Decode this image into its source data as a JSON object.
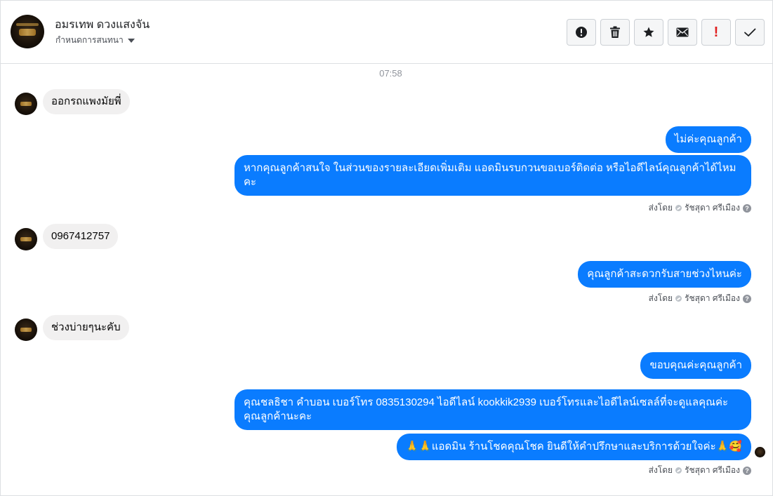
{
  "header": {
    "contact_name": "อมรเทพ ดวงแสงจัน",
    "subtitle": "กำหนดการสนทนา",
    "avatar_icon": "contact-avatar-image",
    "actions": [
      {
        "name": "report-button",
        "icon": "alert-circle-icon"
      },
      {
        "name": "delete-button",
        "icon": "trash-icon"
      },
      {
        "name": "star-button",
        "icon": "star-icon"
      },
      {
        "name": "mark-unread-button",
        "icon": "envelope-icon"
      },
      {
        "name": "spam-button",
        "icon": "exclamation-icon",
        "glyph": "!"
      },
      {
        "name": "mark-done-button",
        "icon": "checkmark-icon"
      }
    ]
  },
  "conversation": {
    "timestamp": "07:58",
    "messages": [
      {
        "direction": "in",
        "text": "ออกรถแพงมัยพี่"
      },
      {
        "direction": "out",
        "text": "ไม่ค่ะคุณลูกค้า"
      },
      {
        "direction": "out",
        "text": "หากคุณลูกค้าสนใจ ในส่วนของรายละเอียดเพิ่มเติม แอดมินรบกวนขอเบอร์ติดต่อ หรือไอดีไลน์คุณลูกค้าได้ไหมคะ"
      },
      {
        "direction": "in",
        "text": "0967412757"
      },
      {
        "direction": "out",
        "text": "คุณลูกค้าสะดวกรับสายช่วงไหนค่ะ"
      },
      {
        "direction": "in",
        "text": "ช่วงบ่ายๆนะคับ"
      },
      {
        "direction": "out",
        "text": "ขอบคุณค่ะคุณลูกค้า"
      },
      {
        "direction": "out",
        "text": "คุณชลธิชา คำบอน เบอร์โทร 0835130294  ไอดีไลน์ kookkik2939   เบอร์โทรและไอดีไลน์เซลล์ที่จะดูแลคุณค่ะคุณลูกค้านะคะ"
      },
      {
        "direction": "out",
        "text": "🙏🙏แอดมิน ร้านโชคคุณโชค ยินดีให้คำปรึกษาและบริการด้วยใจค่ะ🙏🥰"
      }
    ],
    "sent_by": {
      "prefix": "ส่งโดย",
      "agent": "รัชสุดา ศรีเมือง",
      "help_glyph": "?"
    }
  },
  "colors": {
    "outgoing_bubble": "#0a7cff",
    "incoming_bubble": "#f1f0f0",
    "spam_icon": "#e02020"
  }
}
